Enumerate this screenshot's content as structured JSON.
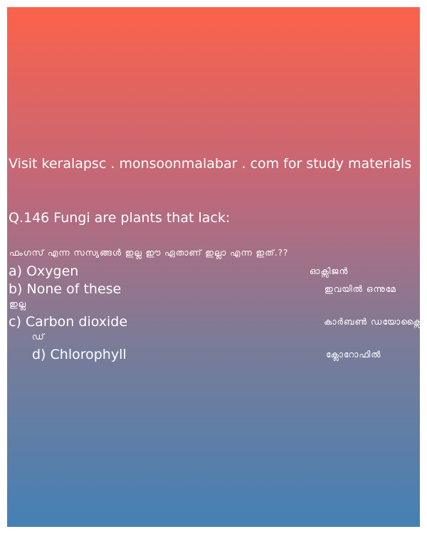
{
  "site_line": "Visit keralapsc . monsoonmalabar . com for study materials",
  "question": {
    "title": "Q.146 Fungi are plants that lack:",
    "malayalam": "ഫംഗസ് എന്ന സസ്യങ്ങൾ ഇല്ല ഈ ഏതാണ് ഇല്ലാ എന്ന ഇത്.??"
  },
  "options": [
    {
      "text": "a) Oxygen",
      "malayalam": "ഓക്സിജൻ",
      "malayalam_cont": ""
    },
    {
      "text": "b) None of these",
      "malayalam": "ഇവയിൽ ഒന്നുമേ",
      "malayalam_cont": "ഇല്ല"
    },
    {
      "text": "c) Carbon dioxide",
      "malayalam": "കാർബൺ ഡയോക്സൈ",
      "malayalam_cont": "ഡ്"
    },
    {
      "text": "d) Chlorophyll",
      "malayalam": "ക്ലോറോഫിൽ",
      "malayalam_cont": ""
    }
  ]
}
